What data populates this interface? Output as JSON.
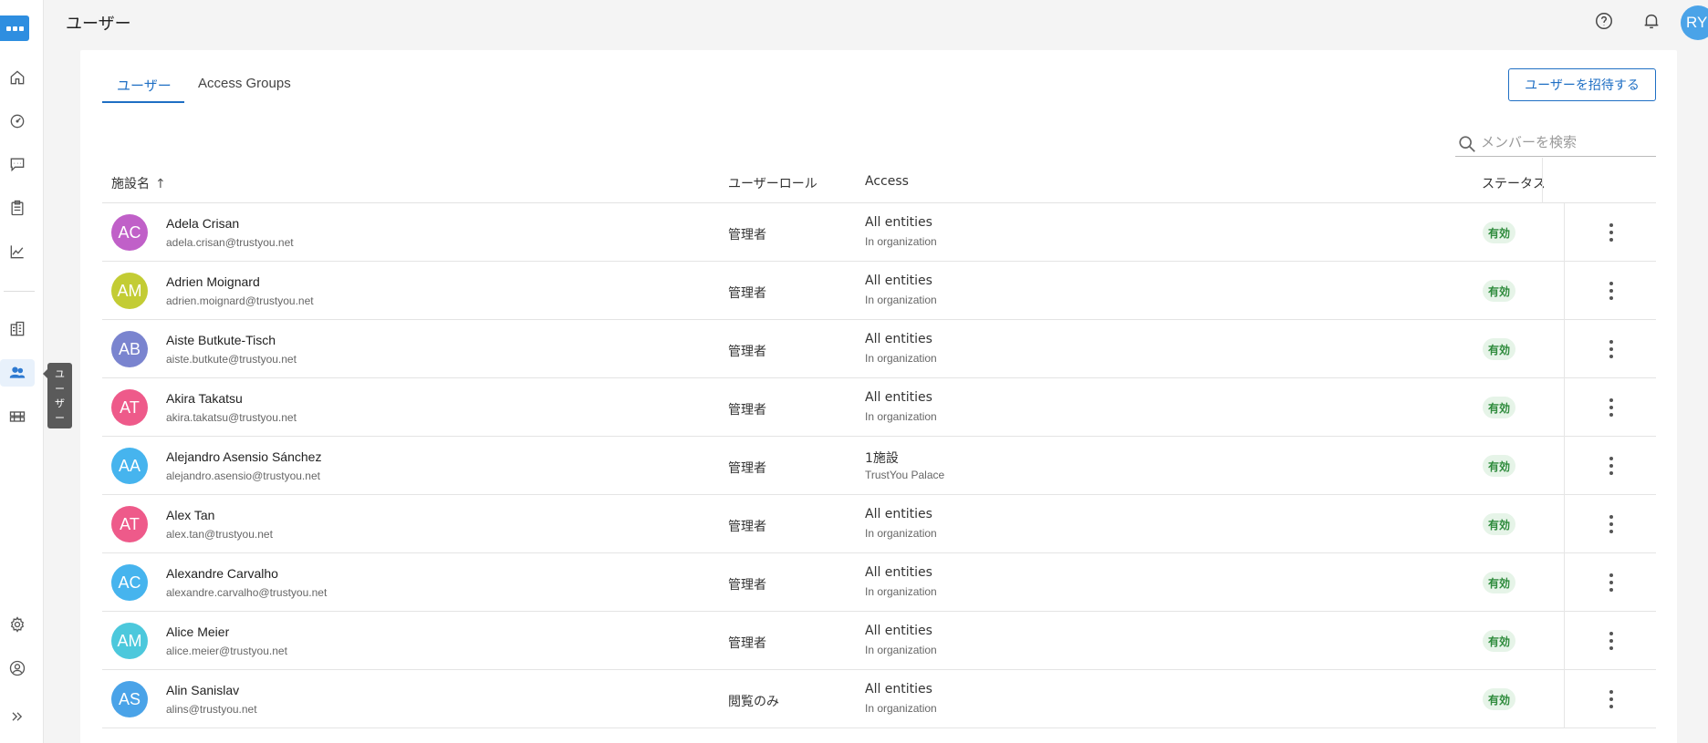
{
  "header": {
    "title": "ユーザー",
    "user_initials": "RY"
  },
  "sidebar": {
    "tooltip": "ユーザー",
    "active": "users"
  },
  "tabs": [
    {
      "label": "ユーザー",
      "active": true
    },
    {
      "label": "Access Groups",
      "active": false
    }
  ],
  "invite_button": "ユーザーを招待する",
  "search": {
    "placeholder": "メンバーを検索",
    "value": ""
  },
  "table": {
    "columns": {
      "name": "施設名",
      "role": "ユーザーロール",
      "access": "Access",
      "status": "ステータス"
    },
    "sort_indicator": "↑",
    "rows": [
      {
        "initials": "AC",
        "color": "#c060c8",
        "name": "Adela Crisan",
        "email": "adela.crisan@trustyou.net",
        "role": "管理者",
        "access": "All entities",
        "access_sub": "In organization",
        "status": "有効"
      },
      {
        "initials": "AM",
        "color": "#c3cc34",
        "name": "Adrien Moignard",
        "email": "adrien.moignard@trustyou.net",
        "role": "管理者",
        "access": "All entities",
        "access_sub": "In organization",
        "status": "有効"
      },
      {
        "initials": "AB",
        "color": "#7a84cf",
        "name": "Aiste Butkute-Tisch",
        "email": "aiste.butkute@trustyou.net",
        "role": "管理者",
        "access": "All entities",
        "access_sub": "In organization",
        "status": "有効"
      },
      {
        "initials": "AT",
        "color": "#ee5a8a",
        "name": "Akira Takatsu",
        "email": "akira.takatsu@trustyou.net",
        "role": "管理者",
        "access": "All entities",
        "access_sub": "In organization",
        "status": "有効"
      },
      {
        "initials": "AA",
        "color": "#46b4ee",
        "name": "Alejandro Asensio Sánchez",
        "email": "alejandro.asensio@trustyou.net",
        "role": "管理者",
        "access": "1施設",
        "access_sub": "TrustYou Palace",
        "status": "有効"
      },
      {
        "initials": "AT",
        "color": "#ee5a8a",
        "name": "Alex Tan",
        "email": "alex.tan@trustyou.net",
        "role": "管理者",
        "access": "All entities",
        "access_sub": "In organization",
        "status": "有効"
      },
      {
        "initials": "AC",
        "color": "#46b4ee",
        "name": "Alexandre Carvalho",
        "email": "alexandre.carvalho@trustyou.net",
        "role": "管理者",
        "access": "All entities",
        "access_sub": "In organization",
        "status": "有効"
      },
      {
        "initials": "AM",
        "color": "#4cc8dc",
        "name": "Alice Meier",
        "email": "alice.meier@trustyou.net",
        "role": "管理者",
        "access": "All entities",
        "access_sub": "In organization",
        "status": "有効"
      },
      {
        "initials": "AS",
        "color": "#4aa3e8",
        "name": "Alin Sanislav",
        "email": "alins@trustyou.net",
        "role": "閲覧のみ",
        "access": "All entities",
        "access_sub": "In organization",
        "status": "有効"
      }
    ]
  }
}
